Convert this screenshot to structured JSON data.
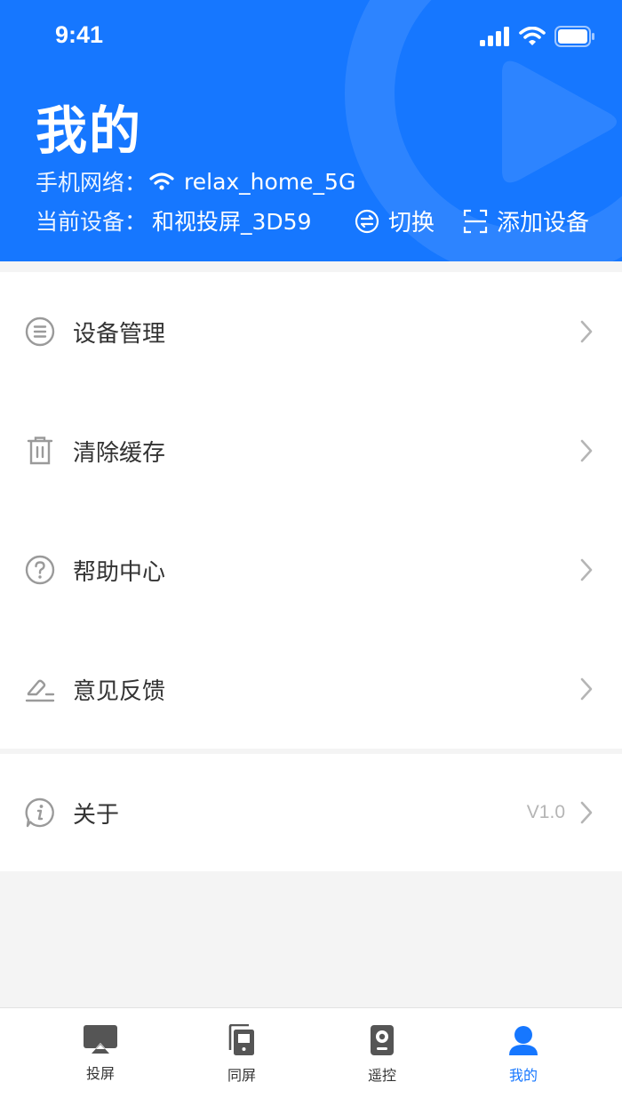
{
  "status_bar": {
    "time": "9:41",
    "icons": [
      "signal-icon",
      "wifi-icon",
      "battery-icon"
    ]
  },
  "header": {
    "title": "我的",
    "network_label": "手机网络：",
    "network_name": "relax_home_5G",
    "device_label": "当前设备：",
    "device_name": "和视投屏_3D59",
    "switch_label": "切换",
    "add_device_label": "添加设备"
  },
  "menu": {
    "items": [
      {
        "label": "设备管理",
        "icon": "list-circle-icon"
      },
      {
        "label": "清除缓存",
        "icon": "trash-icon"
      },
      {
        "label": "帮助中心",
        "icon": "help-circle-icon"
      },
      {
        "label": "意见反馈",
        "icon": "edit-feedback-icon"
      }
    ],
    "about": {
      "label": "关于",
      "icon": "info-icon",
      "version": "V1.0"
    }
  },
  "tabbar": {
    "tabs": [
      {
        "label": "投屏",
        "icon": "cast-icon"
      },
      {
        "label": "同屏",
        "icon": "mirror-screen-icon"
      },
      {
        "label": "遥控",
        "icon": "remote-icon"
      },
      {
        "label": "我的",
        "icon": "user-icon"
      }
    ],
    "active_index": 3
  },
  "colors": {
    "primary": "#1677ff",
    "text": "#333333",
    "muted": "#b5b5b5",
    "background": "#f4f4f4"
  }
}
